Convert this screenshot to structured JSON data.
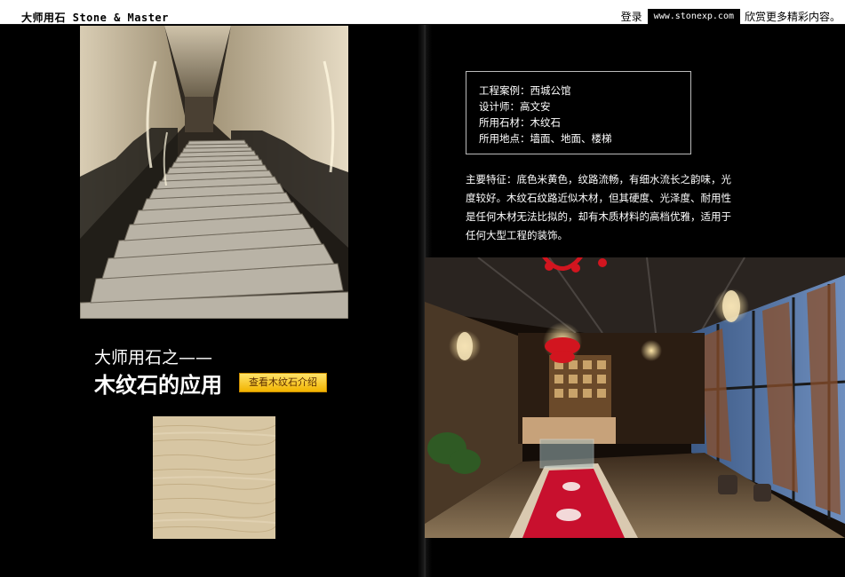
{
  "header": {
    "brand": "大师用石 Stone & Master",
    "login": "登录",
    "url": "www.stonexp.com",
    "more": "欣赏更多精彩内容。"
  },
  "left_page": {
    "headline_line1": "大师用石之——",
    "headline_line2": "木纹石的应用",
    "intro_button": "查看木纹石介绍"
  },
  "right_page": {
    "info": [
      "工程案例：西城公馆",
      "设计师：高文安",
      "所用石材：木纹石",
      "所用地点：墙面、地面、楼梯"
    ],
    "description": "主要特征：底色米黄色，纹路流畅，有细水流长之韵味，光度较好。木纹石纹路近似木材，但其硬度、光泽度、耐用性是任何木材无法比拟的，却有木质材料的高档优雅，适用于任何大型工程的装饰。"
  },
  "colors": {
    "page_background": "#000000",
    "button_gradient_top": "#ffe36a",
    "button_gradient_bottom": "#f2b400",
    "accent_red": "#c8102e"
  }
}
